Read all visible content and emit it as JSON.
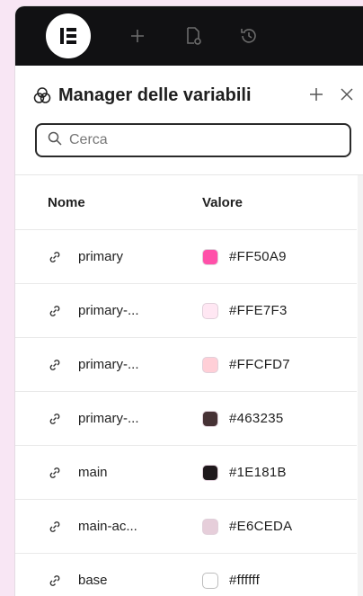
{
  "toolbar": {
    "icons": [
      "elementor-logo-icon",
      "add-icon",
      "page-settings-icon",
      "history-icon"
    ]
  },
  "panel": {
    "title": "Manager delle variabili",
    "search": {
      "placeholder": "Cerca",
      "value": ""
    }
  },
  "table": {
    "headers": {
      "name": "Nome",
      "value": "Valore"
    },
    "rows": [
      {
        "name": "primary",
        "value": "#FF50A9",
        "color": "#FF50A9"
      },
      {
        "name": "primary-...",
        "value": "#FFE7F3",
        "color": "#FFE7F3"
      },
      {
        "name": "primary-...",
        "value": "#FFCFD7",
        "color": "#FFCFD7"
      },
      {
        "name": "primary-...",
        "value": "#463235",
        "color": "#463235"
      },
      {
        "name": "main",
        "value": "#1E181B",
        "color": "#1E181B"
      },
      {
        "name": "main-ac...",
        "value": "#E6CEDA",
        "color": "#E6CEDA"
      },
      {
        "name": "base",
        "value": "#ffffff",
        "color": "#ffffff"
      }
    ]
  },
  "colors": {
    "background": "#f8e6f4",
    "topbar": "#111113"
  }
}
